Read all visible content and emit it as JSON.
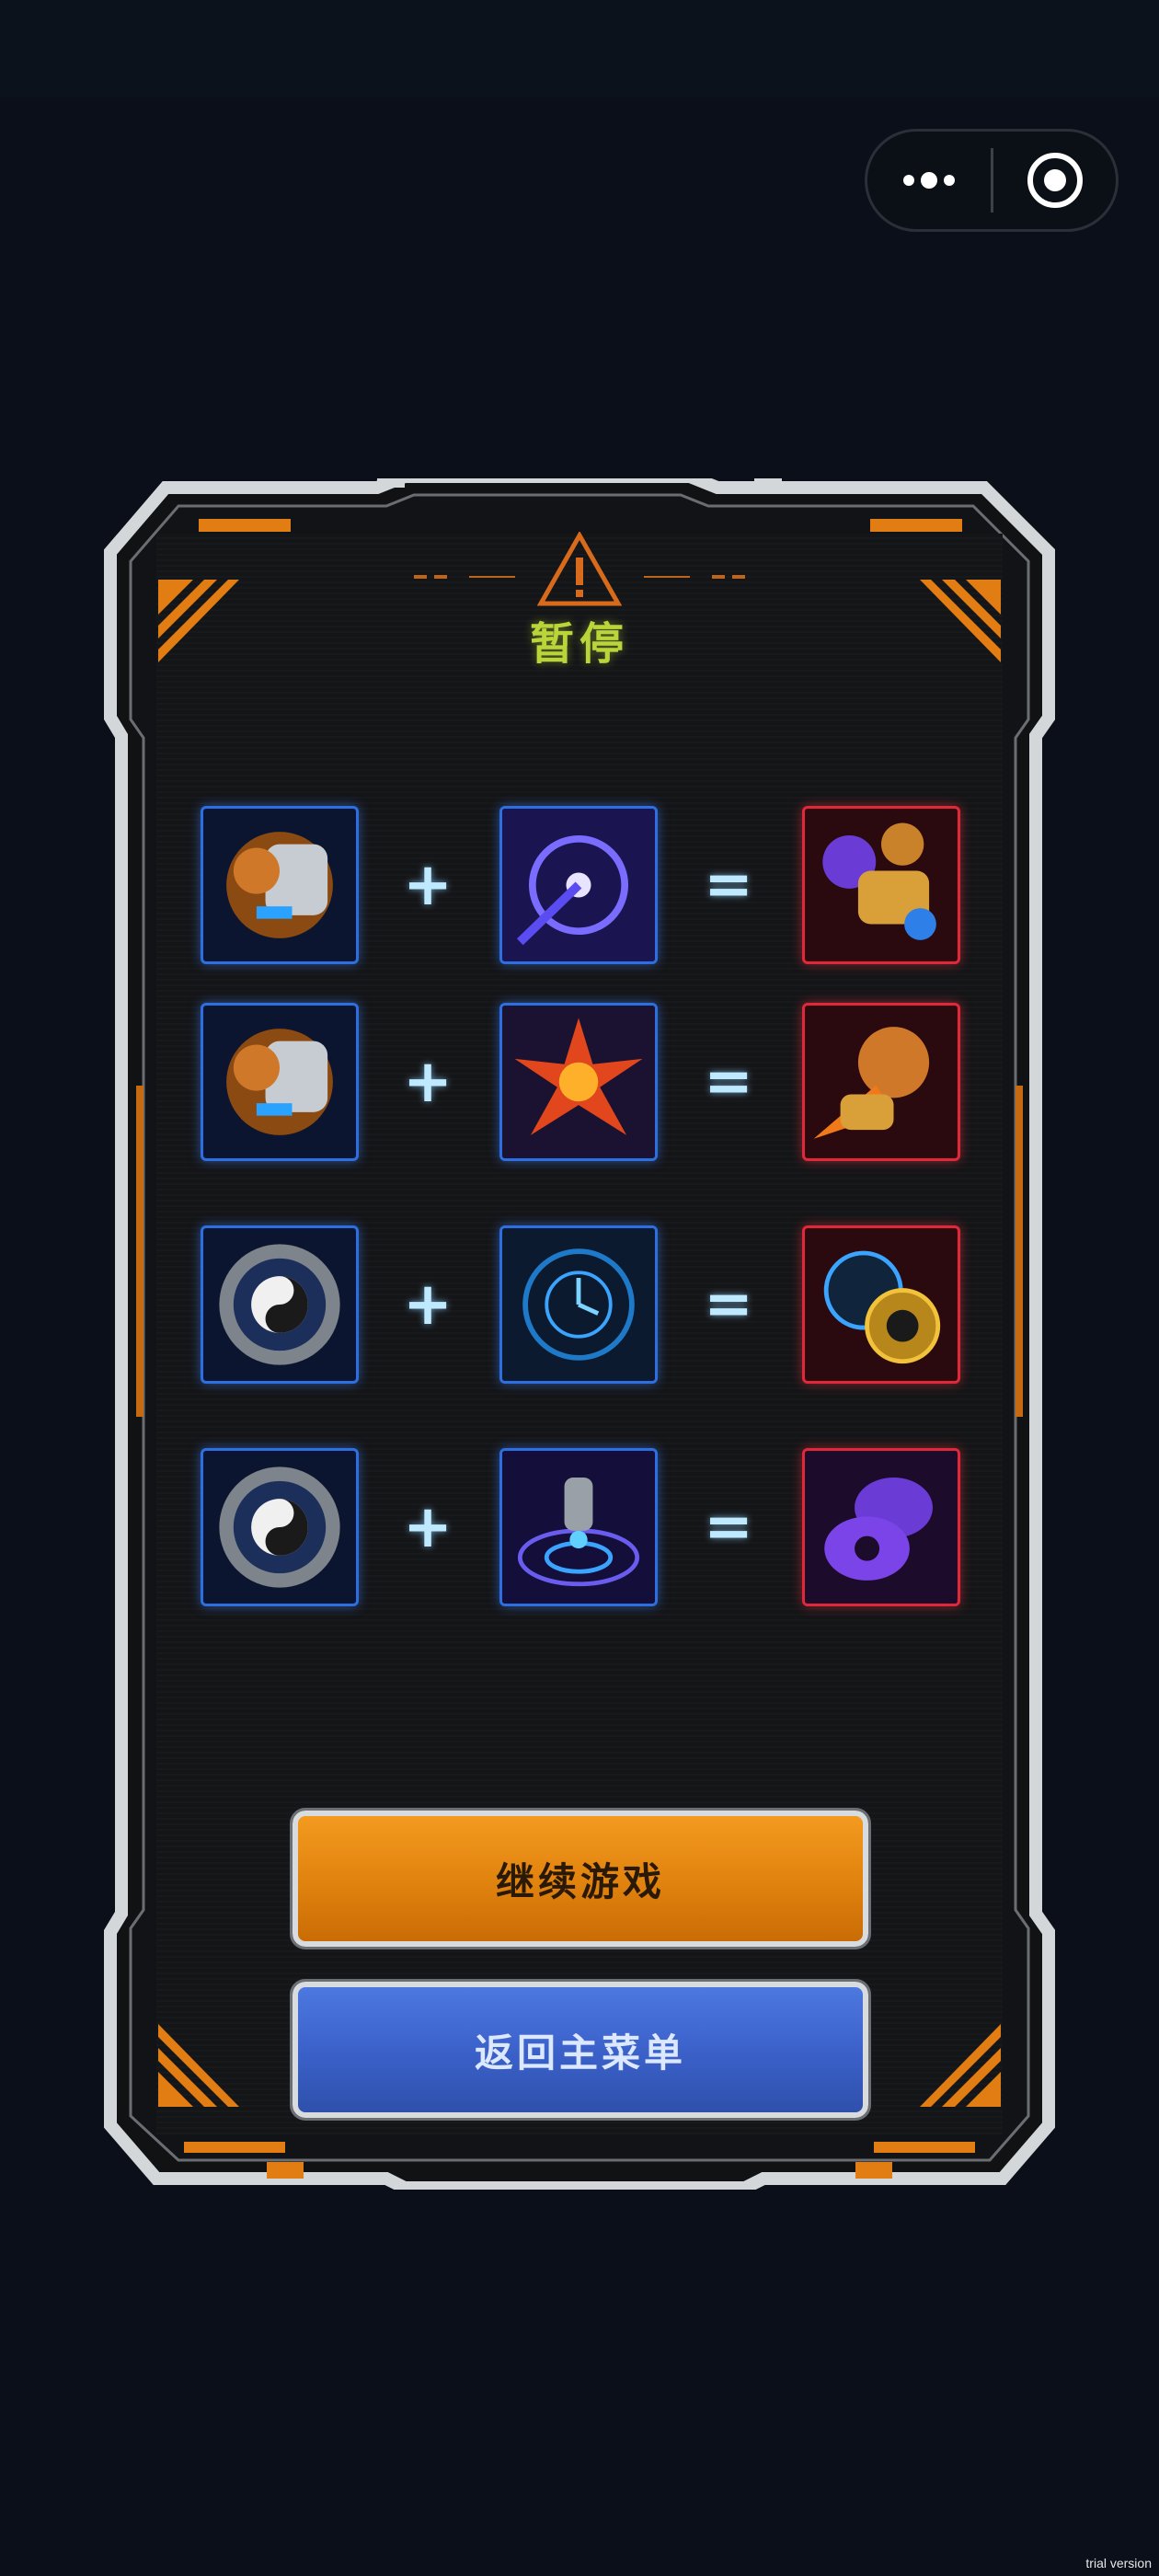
{
  "header": {
    "capsule": {
      "more_icon": "more-dots-icon",
      "close_icon": "target-circle-icon"
    }
  },
  "dialog": {
    "warning_icon": "warning-triangle-icon",
    "title": "暂停"
  },
  "recipes": [
    {
      "input_a": "tiger-fist-gauntlet-icon",
      "op_plus": "+",
      "input_b": "crosshair-scope-icon",
      "op_equals": "=",
      "output": "dual-beast-gauntlet-icon"
    },
    {
      "input_a": "tiger-fist-gauntlet-icon",
      "op_plus": "+",
      "input_b": "explosive-core-icon",
      "op_equals": "=",
      "output": "roaring-tiger-fist-icon"
    },
    {
      "input_a": "yin-yang-gear-icon",
      "op_plus": "+",
      "input_b": "time-radar-icon",
      "op_equals": "=",
      "output": "clock-yin-yang-icon"
    },
    {
      "input_a": "yin-yang-gear-icon",
      "op_plus": "+",
      "input_b": "energy-field-icon",
      "op_equals": "=",
      "output": "purple-chip-stack-icon"
    }
  ],
  "buttons": {
    "continue_label": "继续游戏",
    "menu_label": "返回主菜单"
  },
  "footer": {
    "watermark": "trial version"
  },
  "colors": {
    "background": "#0a0f19",
    "title": "#b9d53a",
    "accent_orange": "#f39a1f",
    "accent_blue": "#3a60c8",
    "input_border": "#2d6fe0",
    "output_border": "#e0283a"
  }
}
